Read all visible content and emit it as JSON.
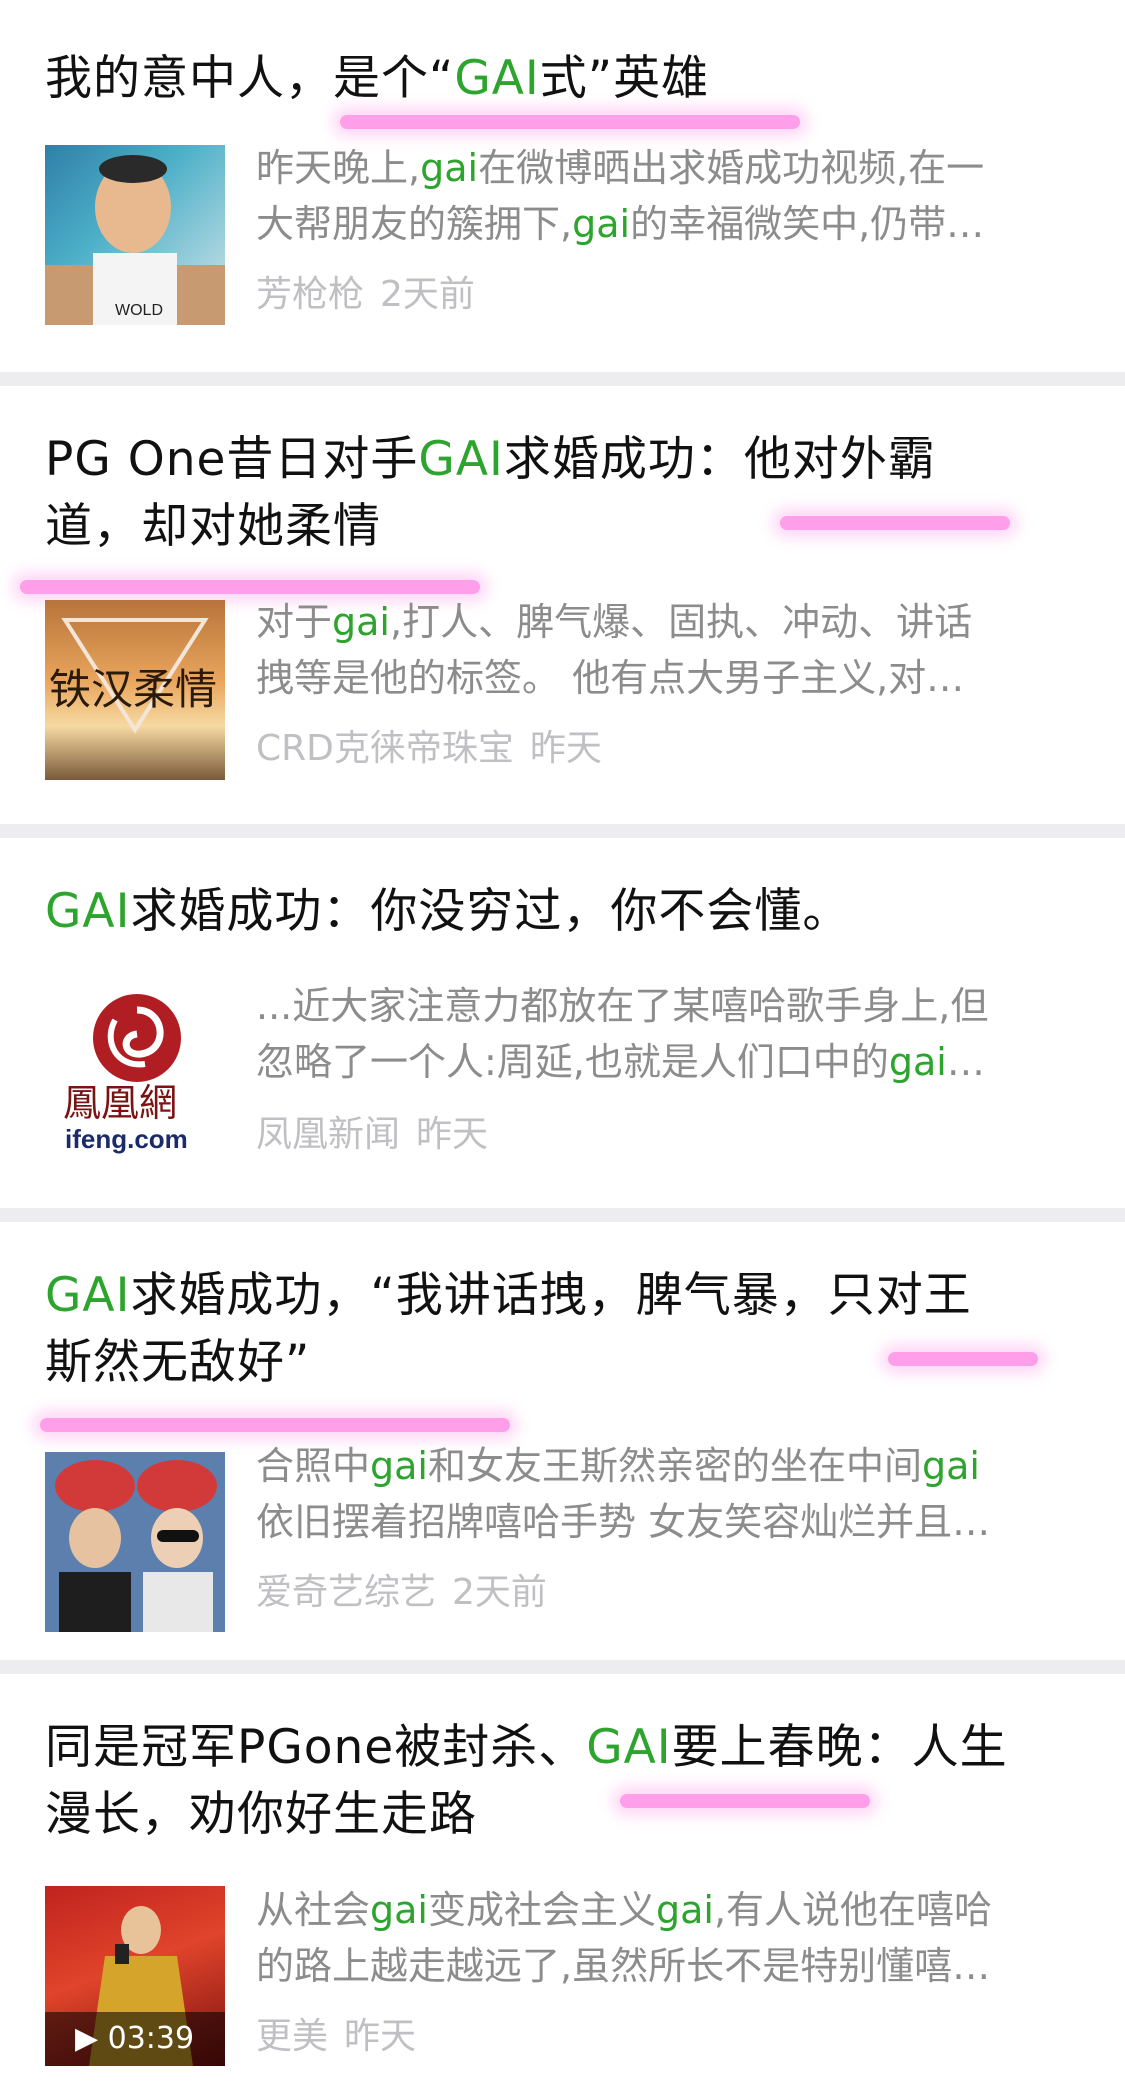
{
  "colors": {
    "highlight": "#2da42d",
    "title": "#111111",
    "snippet": "#8c8c8c",
    "meta": "#c0c0c4",
    "marker": "#ff4fd8",
    "separator": "#ededf0"
  },
  "articles": [
    {
      "title": [
        {
          "t": "我的意中人，是个“"
        },
        {
          "t": "GAI",
          "hl": true
        },
        {
          "t": "式”英雄"
        }
      ],
      "snippet": [
        [
          {
            "t": "昨天晚上,"
          },
          {
            "t": "gai",
            "hl": true
          },
          {
            "t": "在微博晒出求婚成功视频,在一"
          }
        ],
        [
          {
            "t": "大帮朋友的簇拥下,"
          },
          {
            "t": "gai",
            "hl": true
          },
          {
            "t": "的幸福微笑中,仍带…"
          }
        ]
      ],
      "source": "芳枪枪",
      "time": "2天前",
      "thumb_icon": "man-portrait-thumbnail"
    },
    {
      "title": [
        {
          "t": "PG One昔日对手"
        },
        {
          "t": "GAI",
          "hl": true
        },
        {
          "t": "求婚成功：他对外霸"
        },
        {
          "br": true
        },
        {
          "t": "道，却对她柔情"
        }
      ],
      "snippet": [
        [
          {
            "t": "对于"
          },
          {
            "t": "gai",
            "hl": true
          },
          {
            "t": ",打人、脾气爆、固执、冲动、讲话"
          }
        ],
        [
          {
            "t": "拽等是他的标签。 他有点大男子主义,对…"
          }
        ]
      ],
      "source": "CRD克徕帝珠宝",
      "time": "昨天",
      "thumb_icon": "sunset-poster-thumbnail",
      "thumb_text": "铁汉柔情"
    },
    {
      "title": [
        {
          "t": "GAI",
          "hl": true
        },
        {
          "t": "求婚成功：你没穷过，你不会懂。"
        }
      ],
      "snippet": [
        [
          {
            "t": "...近大家注意力都放在了某嘻哈歌手身上,但"
          }
        ],
        [
          {
            "t": "忽略了一个人:周延,也就是人们口中的"
          },
          {
            "t": "gai",
            "hl": true
          },
          {
            "t": "…"
          }
        ]
      ],
      "source": "凤凰新闻",
      "time": "昨天",
      "thumb_icon": "ifeng-logo-thumbnail",
      "thumb_cn": "鳳凰網",
      "thumb_en": "ifeng.com"
    },
    {
      "title": [
        {
          "t": "GAI",
          "hl": true
        },
        {
          "t": "求婚成功，“我讲话拽，脾气暴，只对王"
        },
        {
          "br": true
        },
        {
          "t": "斯然无敌好”"
        }
      ],
      "snippet": [
        [
          {
            "t": "合照中"
          },
          {
            "t": "gai",
            "hl": true
          },
          {
            "t": "和女友王斯然亲密的坐在中间"
          },
          {
            "t": "gai",
            "hl": true
          }
        ],
        [
          {
            "t": "依旧摆着招牌嘻哈手势 女友笑容灿烂并且…"
          }
        ]
      ],
      "source": "爱奇艺综艺",
      "time": "2天前",
      "thumb_icon": "couple-photo-thumbnail"
    },
    {
      "title": [
        {
          "t": "同是冠军PGone被封杀、"
        },
        {
          "t": "GAI",
          "hl": true
        },
        {
          "t": "要上春晚：人生"
        },
        {
          "br": true
        },
        {
          "t": "漫长，劝你好生走路"
        }
      ],
      "snippet": [
        [
          {
            "t": "从社会"
          },
          {
            "t": "gai",
            "hl": true
          },
          {
            "t": "变成社会主义"
          },
          {
            "t": "gai",
            "hl": true
          },
          {
            "t": ",有人说他在嘻哈"
          }
        ],
        [
          {
            "t": "的路上越走越远了,虽然所长不是特别懂嘻…"
          }
        ]
      ],
      "source": "更美",
      "time": "昨天",
      "thumb_icon": "video-thumbnail",
      "duration": "03:39"
    }
  ]
}
